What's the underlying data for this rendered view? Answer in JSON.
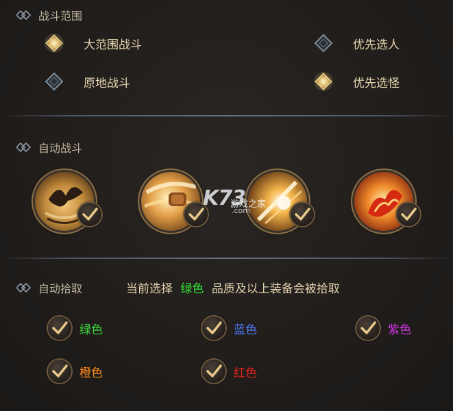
{
  "sections": {
    "range": {
      "title": "战斗范围",
      "options": [
        {
          "label": "大范围战斗",
          "selected": true
        },
        {
          "label": "优先选人",
          "selected": false
        },
        {
          "label": "原地战斗",
          "selected": false
        },
        {
          "label": "优先选怪",
          "selected": true
        }
      ]
    },
    "auto_fight": {
      "title": "自动战斗",
      "skills": [
        {
          "icon": "dark-bird-skill-icon",
          "checked": true
        },
        {
          "icon": "fist-strike-skill-icon",
          "checked": true
        },
        {
          "icon": "slash-burst-skill-icon",
          "checked": true
        },
        {
          "icon": "fire-phoenix-skill-icon",
          "checked": true
        }
      ]
    },
    "auto_pick": {
      "title": "自动拾取",
      "desc_prefix": "当前选择",
      "desc_highlight": "绿色",
      "desc_suffix": "品质及以上装备会被拾取",
      "qualities": [
        {
          "label": "绿色",
          "color": "#3fd63f",
          "checked": true
        },
        {
          "label": "蓝色",
          "color": "#4f7bff",
          "checked": true
        },
        {
          "label": "紫色",
          "color": "#d434e8",
          "checked": true
        },
        {
          "label": "橙色",
          "color": "#ff8a1c",
          "checked": true
        },
        {
          "label": "红色",
          "color": "#e8261c",
          "checked": true
        }
      ]
    }
  },
  "watermark": {
    "big": "K73",
    "small": "游戏之家",
    "domain": ".com"
  },
  "colors": {
    "gold_check": "#e8c98a",
    "divider": "#6a7282",
    "highlight_green": "#33e636"
  }
}
